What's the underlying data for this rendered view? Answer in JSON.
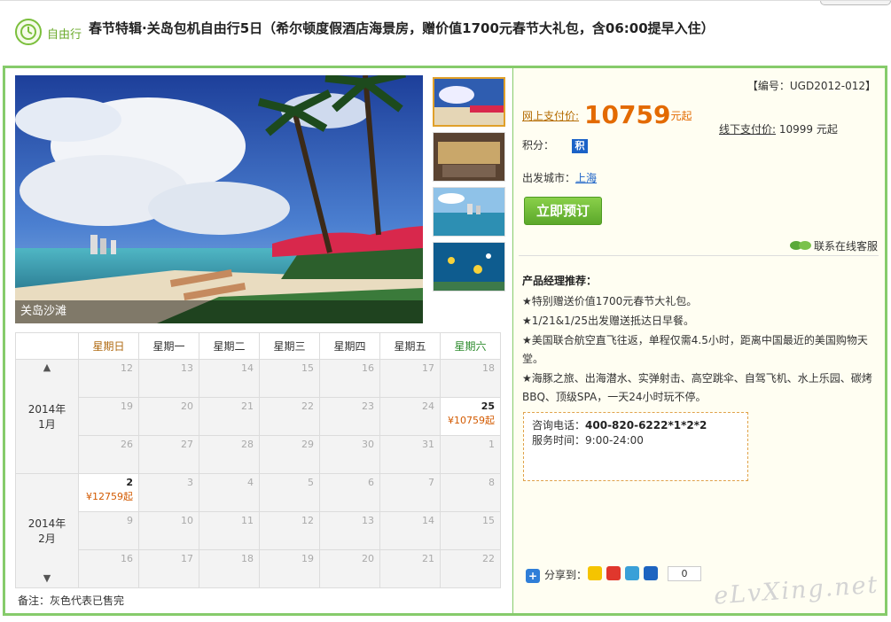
{
  "header": {
    "tag": "自由行",
    "title": "春节特辑·关岛包机自由行5日（希尔顿度假酒店海景房，赠价值1700元春节大礼包，含06:00提早入住）"
  },
  "photo": {
    "caption": "关岛沙滩"
  },
  "calendar": {
    "weekdays": [
      "星期日",
      "星期一",
      "星期二",
      "星期三",
      "星期四",
      "星期五",
      "星期六"
    ],
    "month1": {
      "label": "2014年\n1月"
    },
    "month2": {
      "label": "2014年\n2月"
    },
    "rows": [
      [
        "12",
        "13",
        "14",
        "15",
        "16",
        "17",
        "18"
      ],
      [
        "19",
        "20",
        "21",
        "22",
        "23",
        "24",
        "25"
      ],
      [
        "26",
        "27",
        "28",
        "29",
        "30",
        "31",
        "1"
      ],
      [
        "2",
        "3",
        "4",
        "5",
        "6",
        "7",
        "8"
      ],
      [
        "9",
        "10",
        "11",
        "12",
        "13",
        "14",
        "15"
      ],
      [
        "16",
        "17",
        "18",
        "19",
        "20",
        "21",
        "22"
      ]
    ],
    "price_jan25": "¥10759起",
    "price_feb2": "¥12759起",
    "note": "备注：灰色代表已售完"
  },
  "product": {
    "code": "【编号：UGD2012-012】",
    "online_label": "网上支付价:",
    "online_price": "10759",
    "online_unit": "元起",
    "offline_label": "线下支付价:",
    "offline_price": "10999 元起",
    "points_label": "积分：",
    "points_badge": "积",
    "city_label": "出发城市：",
    "city": "上海",
    "book_button": "立即预订",
    "contact": "联系在线客服"
  },
  "recommend": {
    "title": "产品经理推荐：",
    "items": [
      "★特别赠送价值1700元春节大礼包。",
      "★1/21&1/25出发赠送抵达日早餐。",
      "★美国联合航空直飞往返，单程仅需4.5小时，距离中国最近的美国购物天堂。",
      "★海豚之旅、出海潜水、实弹射击、高空跳伞、自驾飞机、水上乐园、碳烤BBQ、顶级SPA，一天24小时玩不停。"
    ]
  },
  "consult": {
    "phone_label": "咨询电话：",
    "phone": "400-820-6222*1*2*2",
    "hours_label": "服务时间：",
    "hours": "9:00-24:00"
  },
  "share": {
    "label": "分享到：",
    "count": "0"
  },
  "watermark": "eLvXing.net"
}
